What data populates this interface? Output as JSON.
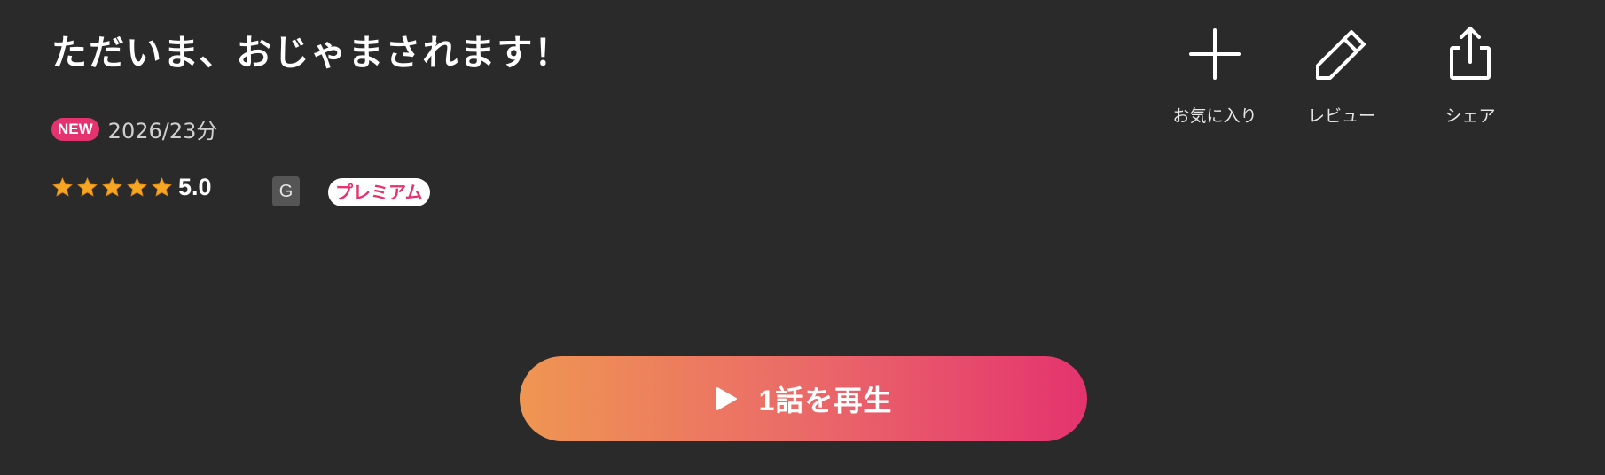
{
  "title": "ただいま、おじゃまされます！",
  "meta": {
    "new_badge": "NEW",
    "info": "2026/23分"
  },
  "rating": {
    "value": "5.0",
    "stars": 5,
    "star_color": "#f5a623"
  },
  "age_rating": "G",
  "premium_label": "プレミアム",
  "actions": [
    {
      "label": "お気に入り",
      "icon": "plus-icon"
    },
    {
      "label": "レビュー",
      "icon": "pencil-icon"
    },
    {
      "label": "シェア",
      "icon": "share-icon"
    }
  ],
  "play_button": {
    "label": "1話を再生",
    "icon": "play-icon",
    "gradient_start": "#ef9652",
    "gradient_end": "#e4336f"
  }
}
